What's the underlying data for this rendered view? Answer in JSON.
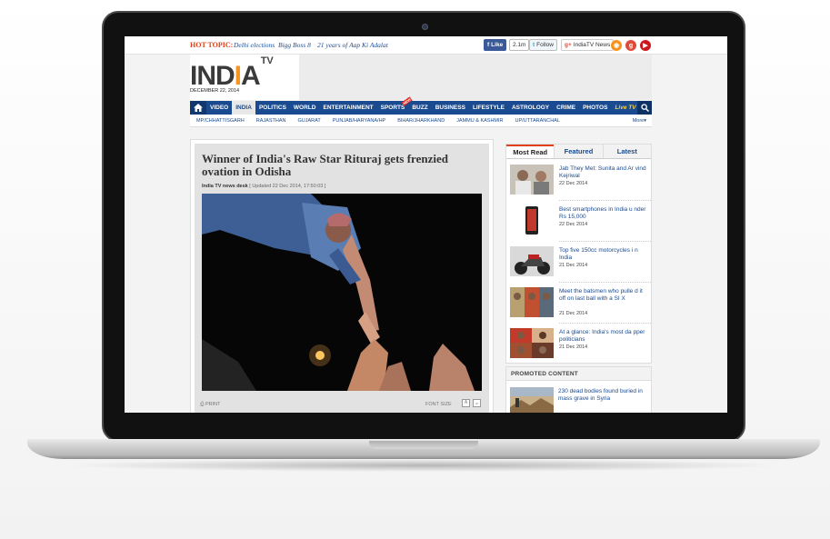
{
  "topbar": {
    "hot_label": "HOT TOPIC:",
    "links": [
      "Delhi elections",
      "Bigg Boss 8",
      "21 years of Aap Ki Adalat"
    ],
    "fb_like": "Like",
    "fb_count": "2.1m",
    "tw_follow": "Follow",
    "gplus_page": "IndiaTV News",
    "icons": [
      "rss-icon",
      "google-plus-icon",
      "youtube-icon"
    ]
  },
  "header": {
    "logo_main": "INDIA",
    "logo_sup": "TV",
    "date": "DECEMBER 22, 2014"
  },
  "nav": {
    "items": [
      "VIDEO",
      "INDIA",
      "POLITICS",
      "WORLD",
      "ENTERTAINMENT",
      "SPORTS",
      "BUZZ",
      "BUSINESS",
      "LIFESTYLE",
      "ASTROLOGY",
      "CRIME",
      "PHOTOS",
      "Live TV"
    ],
    "active": "INDIA",
    "new_badge": "NEW"
  },
  "subnav": {
    "items": [
      "MP/CHHATTISGARH",
      "RAJASTHAN",
      "GUJARAT",
      "PUNJAB/HARYANA/HP",
      "BIHAR/JHARKHAND",
      "JAMMU & KASHMIR",
      "UP/UTTARANCHAL"
    ],
    "more": "More"
  },
  "article": {
    "title": "Winner of India's Raw Star Rituraj gets frenzied ovation in Odisha",
    "author": "India TV news desk",
    "updated": "[ Updated 22 Dec 2014, 17:50:03 ]",
    "print": "PRINT",
    "font_size": "FONT SIZE"
  },
  "sidebar": {
    "tabs": [
      "Most Read",
      "Featured",
      "Latest"
    ],
    "stories": [
      {
        "title": "Jab They Met: Sunita and Ar vind Kejriwal",
        "date": "22 Dec 2014"
      },
      {
        "title": "Best smartphones in India u nder Rs 15,000",
        "date": "22 Dec 2014"
      },
      {
        "title": "Top five 150cc motorcycles i n India",
        "date": "21 Dec 2014"
      },
      {
        "title": "Meet the batsmen who pulle d it off on last ball with a SI X",
        "date": "21 Dec 2014"
      },
      {
        "title": "At a glance: India's most da pper politicians",
        "date": "21 Dec 2014"
      }
    ]
  },
  "promo": {
    "heading": "PROMOTED CONTENT",
    "title": "230 dead bodies found buried in mass grave in Syria"
  },
  "colors": {
    "nav_blue": "#1a4a8f",
    "hot_orange": "#e0401a",
    "logo_orange": "#f7941d"
  }
}
